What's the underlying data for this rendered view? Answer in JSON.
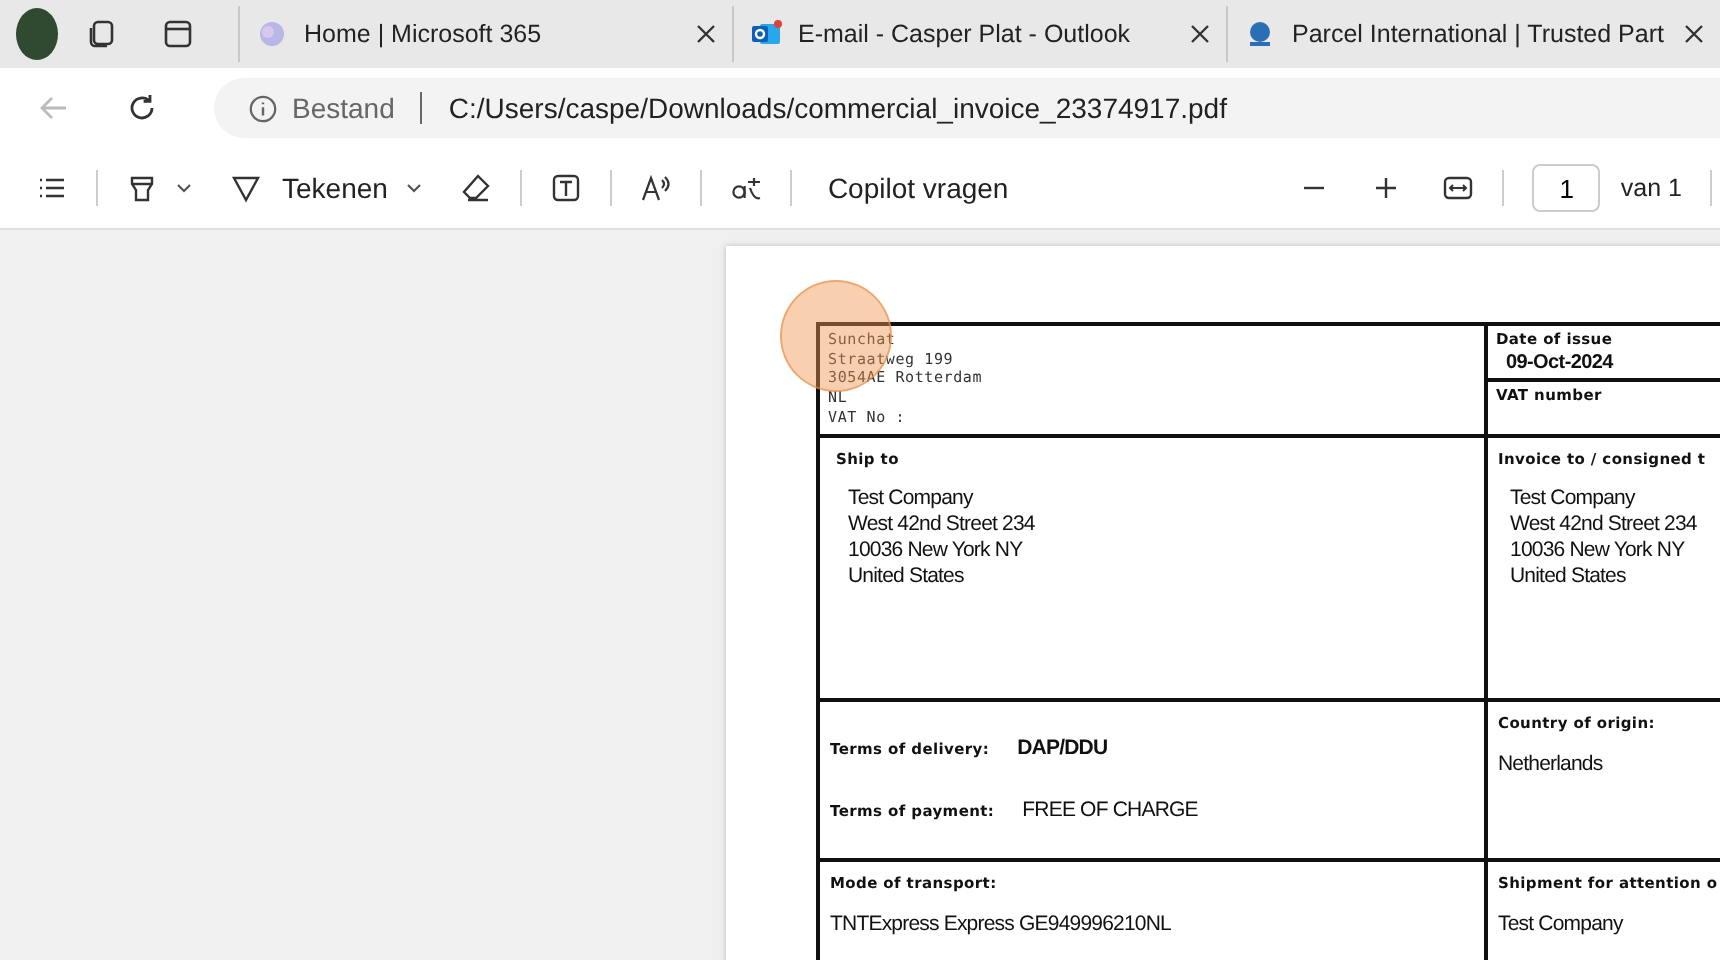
{
  "tabs": [
    {
      "title": "Home | Microsoft 365",
      "kind": "m365",
      "selected": false
    },
    {
      "title": "E-mail - Casper Plat - Outlook",
      "kind": "outlook",
      "selected": false
    },
    {
      "title": "Parcel International | Trusted Part",
      "kind": "parcel",
      "selected": false
    }
  ],
  "address_bar": {
    "site_label": "Bestand",
    "url": "C:/Users/caspe/Downloads/commercial_invoice_23374917.pdf"
  },
  "toolbar": {
    "draw_label": "Tekenen",
    "copilot_label": "Copilot vragen",
    "page_number": "1",
    "page_count": "van 1"
  },
  "document": {
    "sender": [
      "Sunchat",
      "Straatweg 199",
      "3054AE Rotterdam",
      "NL",
      "VAT No :"
    ],
    "date_label": "Date of issue",
    "date": "09-Oct-2024",
    "vat_label": "VAT number",
    "ship_to_label": "Ship to",
    "ship_to": [
      "Test Company",
      "West 42nd Street 234",
      "10036 New York NY",
      "United States"
    ],
    "invoice_to_label": "Invoice to / consigned t",
    "invoice_to": [
      "Test Company",
      "West 42nd Street 234",
      "10036 New York NY",
      "United States"
    ],
    "delivery_label": "Terms of delivery:",
    "delivery": "DAP/DDU",
    "payment_label": "Terms of payment:",
    "payment": "FREE OF CHARGE",
    "origin_label": "Country of origin:",
    "origin": "Netherlands",
    "transport_label": "Mode of transport:",
    "transport": "TNTExpress Express GE949996210NL",
    "attention_label": "Shipment for attention o",
    "attention": "Test Company"
  }
}
